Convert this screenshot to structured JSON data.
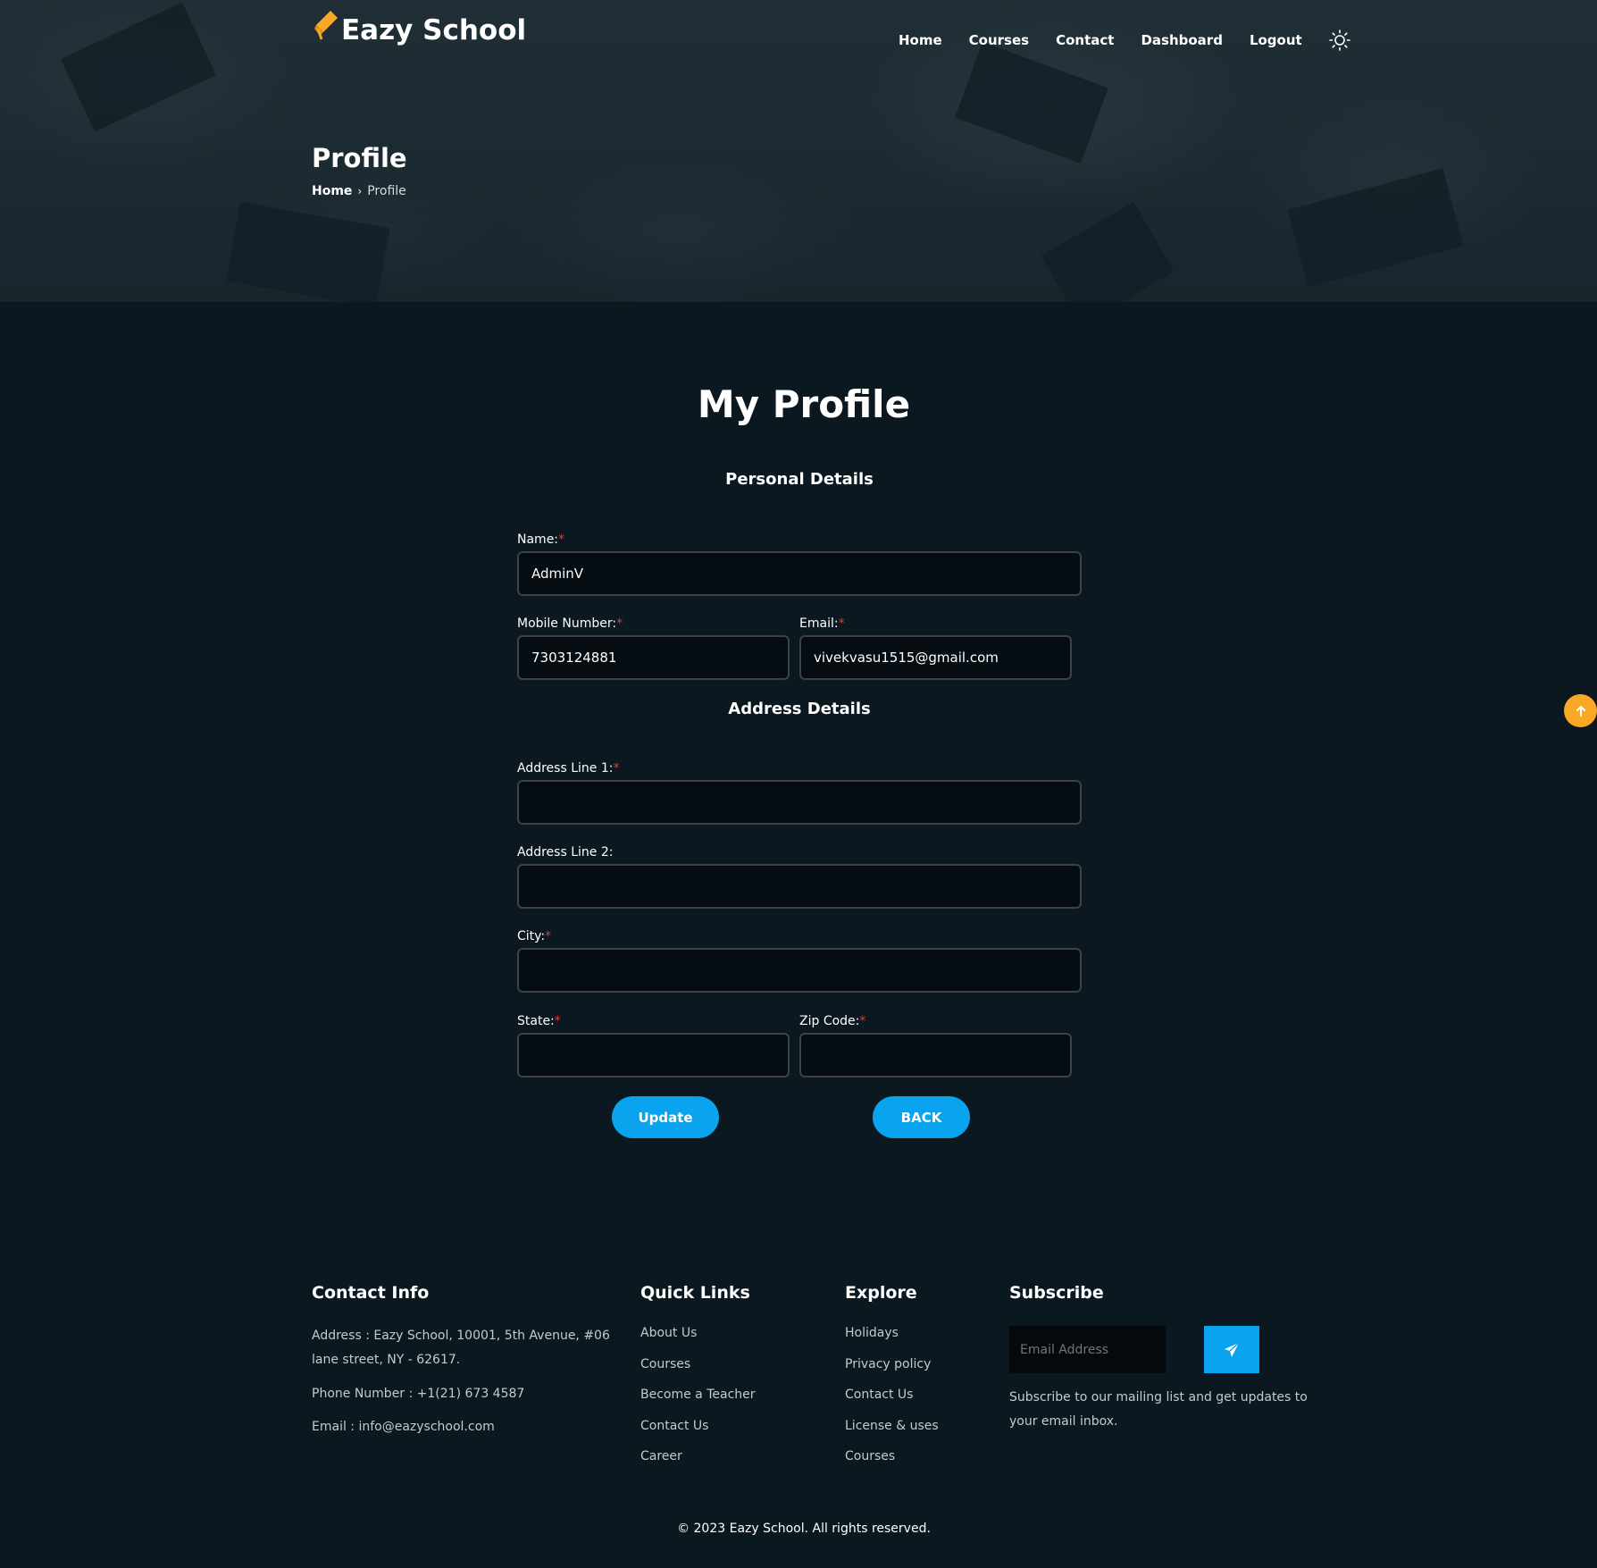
{
  "brand": {
    "name": "Eazy School",
    "accent": "#f9a825",
    "primary": "#0aa4ee"
  },
  "nav": {
    "items": [
      "Home",
      "Courses",
      "Contact",
      "Dashboard",
      "Logout"
    ],
    "theme_icon": "sun-icon"
  },
  "hero": {
    "title": "Profile",
    "breadcrumb_home": "Home",
    "breadcrumb_current": "Profile"
  },
  "form": {
    "title": "My Profile",
    "personal_heading": "Personal Details",
    "address_heading": "Address Details",
    "name": {
      "label": "Name:",
      "value": "AdminV"
    },
    "mobile": {
      "label": "Mobile Number:",
      "value": "7303124881"
    },
    "email": {
      "label": "Email:",
      "value": "vivekvasu1515@gmail.com"
    },
    "address1": {
      "label": "Address Line 1:",
      "value": ""
    },
    "address2": {
      "label": "Address Line 2:",
      "value": ""
    },
    "city": {
      "label": "City:",
      "value": ""
    },
    "state": {
      "label": "State:",
      "value": ""
    },
    "zip": {
      "label": "Zip Code:",
      "value": ""
    },
    "required_mark": "*",
    "update_label": "Update",
    "back_label": "BACK"
  },
  "footer": {
    "contact": {
      "heading": "Contact Info",
      "address_line1": "Address : Eazy School, 10001, 5th Avenue, #06",
      "address_line2": "lane street, NY - 62617.",
      "phone": "Phone Number : +1(21) 673 4587",
      "email": "Email : info@eazyschool.com"
    },
    "quick_links": {
      "heading": "Quick Links",
      "items": [
        "About Us",
        "Courses",
        "Become a Teacher",
        "Contact Us",
        "Career"
      ]
    },
    "explore": {
      "heading": "Explore",
      "items": [
        "Holidays",
        "Privacy policy",
        "Contact Us",
        "License & uses",
        "Courses"
      ]
    },
    "subscribe": {
      "heading": "Subscribe",
      "placeholder": "Email Address",
      "text_line1": "Subscribe to our mailing list and get updates to",
      "text_line2": "your email inbox."
    },
    "copyright": "© 2023 Eazy School. All rights reserved."
  }
}
